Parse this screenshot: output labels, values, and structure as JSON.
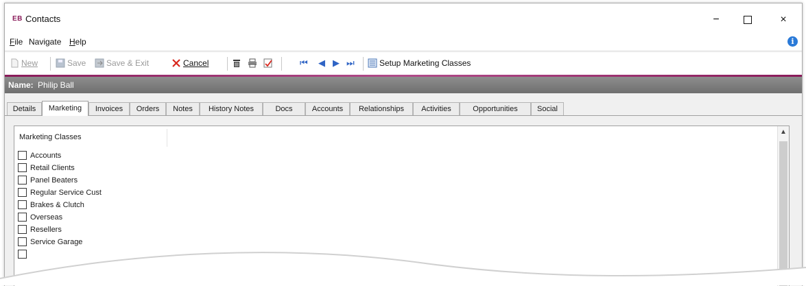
{
  "window": {
    "logo": "EB",
    "title": "Contacts",
    "minimize": "−",
    "close": "×"
  },
  "menu": [
    {
      "name": "file",
      "accel": "F",
      "rest": "ile"
    },
    {
      "name": "navigate",
      "accel": "",
      "rest": "Navigate"
    },
    {
      "name": "help",
      "accel": "H",
      "rest": "elp"
    }
  ],
  "toolbar": {
    "new_label": "New",
    "save_label": "Save",
    "save_exit_label": "Save & Exit",
    "cancel_label": "Cancel",
    "setup_label": "Setup Marketing Classes"
  },
  "record": {
    "name_label": "Name:",
    "name_value": "Philip Ball"
  },
  "tabs": [
    "Details",
    "Marketing",
    "Invoices",
    "Orders",
    "Notes",
    "History Notes",
    "Docs",
    "Accounts",
    "Relationships",
    "Activities",
    "Opportunities",
    "Social"
  ],
  "active_tab": "Marketing",
  "marketing": {
    "header": "Marketing Classes",
    "classes": [
      {
        "label": "Accounts",
        "checked": false
      },
      {
        "label": "Retail Clients",
        "checked": false
      },
      {
        "label": "Panel Beaters",
        "checked": false
      },
      {
        "label": "Regular Service Cust",
        "checked": false
      },
      {
        "label": "Brakes & Clutch",
        "checked": false
      },
      {
        "label": "Overseas",
        "checked": false
      },
      {
        "label": "Resellers",
        "checked": false
      },
      {
        "label": "Service Garage",
        "checked": false
      }
    ]
  },
  "colors": {
    "accent": "#8a1b5a",
    "namebar": "#7a7a7a",
    "nav_arrows": "#2f64c5",
    "cancel_red": "#d8261c"
  }
}
